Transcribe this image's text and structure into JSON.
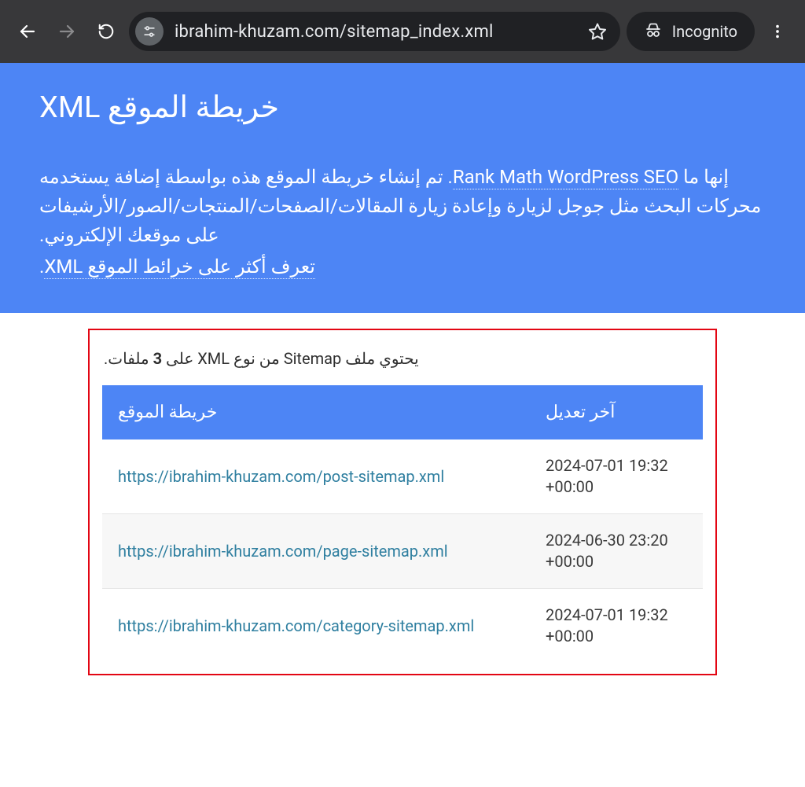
{
  "browser": {
    "url": "ibrahim-khuzam.com/sitemap_index.xml",
    "incognito_label": "Incognito"
  },
  "hero": {
    "title": "خريطة الموقع XML",
    "p1_pre": "إنها ما ",
    "p1_link": "Rank Math WordPress SEO",
    "p1_post": ". تم إنشاء خريطة الموقع هذه بواسطة إضافة يستخدمه محركات البحث مثل جوجل لزيارة وإعادة زيارة المقالات/الصفحات/المنتجات/الصور/الأرشيفات على موقعك الإلكتروني.",
    "p2_pre": "",
    "p2_link": "تعرف أكثر على خرائط الموقع XML",
    "p2_post": "."
  },
  "summary": {
    "prefix": "يحتوي ملف Sitemap من نوع XML على ",
    "count": "3",
    "suffix": " ملفات."
  },
  "table": {
    "col_sitemap": "خريطة الموقع",
    "col_modified": "آخر تعديل",
    "rows": [
      {
        "url": "https://ibrahim-khuzam.com/post-sitemap.xml",
        "mod1": "2024-07-01 19:32",
        "mod2": "+00:00"
      },
      {
        "url": "https://ibrahim-khuzam.com/page-sitemap.xml",
        "mod1": "2024-06-30 23:20",
        "mod2": "+00:00"
      },
      {
        "url": "https://ibrahim-khuzam.com/category-sitemap.xml",
        "mod1": "2024-07-01 19:32",
        "mod2": "+00:00"
      }
    ]
  }
}
